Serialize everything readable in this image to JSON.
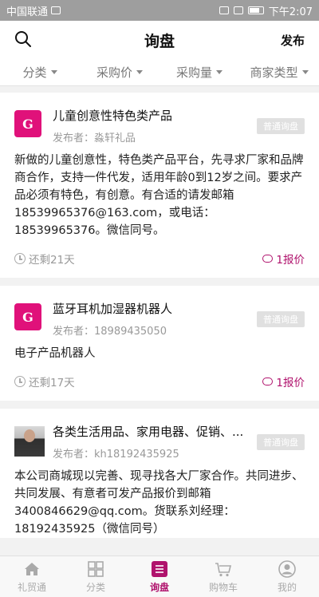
{
  "status_bar": {
    "carrier": "中国联通",
    "time": "下午2:07"
  },
  "header": {
    "title": "询盘",
    "publish": "发布"
  },
  "filters": [
    {
      "label": "分类"
    },
    {
      "label": "采购价"
    },
    {
      "label": "采购量"
    },
    {
      "label": "商家类型"
    }
  ],
  "cards": [
    {
      "logo_text": "G",
      "title": "儿童创意性特色类产品",
      "publisher": "发布者：淼轩礼品",
      "badge": "普通询盘",
      "body": "新做的儿童创意性，特色类产品平台，先寻求厂家和品牌商合作，支持一件代发，适用年龄0到12岁之间。要求产品必须有特色，有创意。有合适的请发邮箱18539965376@163.com，或电话：18539965376。微信同号。",
      "remaining": "还剩21天",
      "quotes": "1报价"
    },
    {
      "logo_text": "G",
      "title": "蓝牙耳机加湿器机器人",
      "publisher": "发布者：18989435050",
      "badge": "普通询盘",
      "body": "电子产品机器人",
      "remaining": "还剩17天",
      "quotes": "1报价"
    },
    {
      "title": "各类生活用品、家用电器、促销、...",
      "publisher": "发布者：kh18192435925",
      "badge": "普通询盘",
      "body": "本公司商城现以完善、现寻找各大厂家合作。共同进步、共同发展、有意者可发产品报价到邮箱3400846629@qq.com。货联系刘经理：18192435925（微信同号）"
    }
  ],
  "tabbar": [
    {
      "label": "礼贸通",
      "icon": "home-icon"
    },
    {
      "label": "分类",
      "icon": "grid-icon"
    },
    {
      "label": "询盘",
      "icon": "list-icon",
      "active": true
    },
    {
      "label": "购物车",
      "icon": "cart-icon"
    },
    {
      "label": "我的",
      "icon": "user-icon"
    }
  ],
  "colors": {
    "accent": "#b0136d",
    "logo_bg": "#e0117a",
    "badge_bg": "#e0e0e0"
  }
}
